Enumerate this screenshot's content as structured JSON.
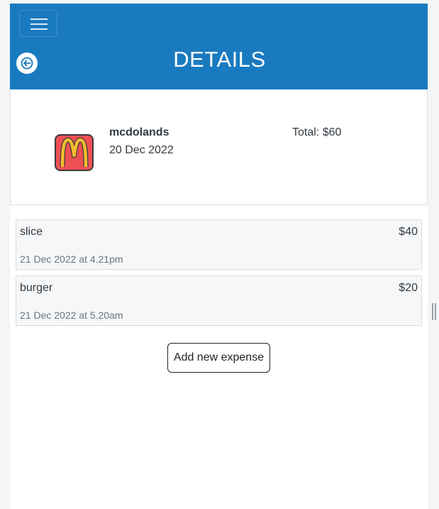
{
  "header": {
    "title": "DETAILS",
    "background": "#1a7abf",
    "menu_icon": "hamburger-icon",
    "back_icon": "arrow-left-icon"
  },
  "summary": {
    "merchant_name": "mcdolands",
    "date": "20 Dec 2022",
    "total": "Total: $60",
    "logo_icon": "mcdonalds-logo"
  },
  "expenses": [
    {
      "name": "slice",
      "amount": "$40",
      "timestamp": "21 Dec 2022 at 4.21pm"
    },
    {
      "name": "burger",
      "amount": "$20",
      "timestamp": "21 Dec 2022 at 5.20am"
    }
  ],
  "actions": {
    "add_expense_label": "Add new expense"
  }
}
